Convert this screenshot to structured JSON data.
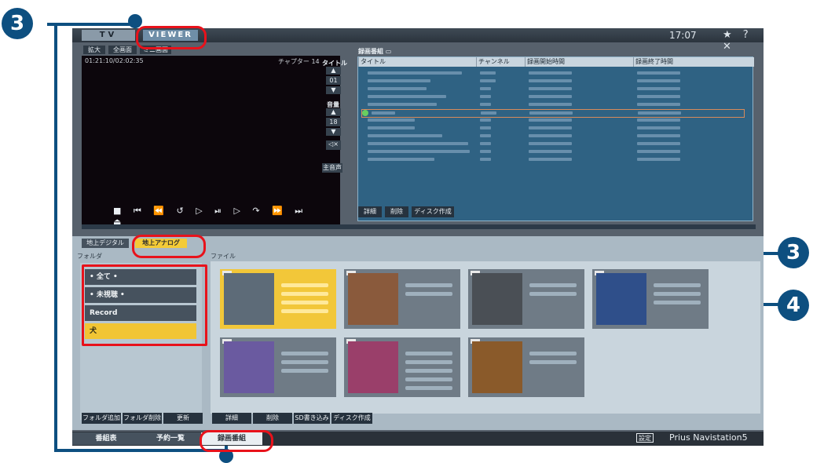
{
  "callouts": {
    "top_left": "3",
    "mid_right": "3",
    "lower_right": "4"
  },
  "top": {
    "tab_tv": "TV",
    "tab_viewer": "VIEWER",
    "clock": "17:07",
    "window_buttons": "★ ? ✕"
  },
  "view_modes": [
    "拡大",
    "全画面",
    "ミニ画面"
  ],
  "player": {
    "time": "01:21:10/02:02:35",
    "chapter": "チャプター 14",
    "transport": "■ ⏮ ⏪ ↺ ▷ ⏯ ▷ ↷ ⏩ ⏭ ⏏"
  },
  "side": {
    "title_label": "タイトル",
    "title_value": "01",
    "volume_label": "音量",
    "volume_value": "18",
    "audio_button": "主音声"
  },
  "recordings": {
    "panel_title": "録画番組",
    "columns": [
      "タイトル",
      "チャンネル",
      "録画開始時間",
      "録画終了時間"
    ],
    "buttons": [
      "詳細",
      "削除",
      "ディスク作成"
    ]
  },
  "lower": {
    "tab_digital": "地上デジタル",
    "tab_analog": "地上アナログ",
    "folder_label": "フォルダ",
    "file_label": "ファイル",
    "folders": [
      "• 全て •",
      "• 未視聴 •",
      "Record",
      "犬"
    ],
    "folder_buttons": [
      "フォルダ追加",
      "フォルダ削除",
      "更新"
    ],
    "file_buttons": [
      "詳細",
      "削除",
      "SD書き込み",
      "ディスク作成"
    ]
  },
  "bottom": {
    "tabs": [
      "番組表",
      "予約一覧",
      "録画番組"
    ],
    "settings": "設定",
    "brand": "Prius Navistation5"
  }
}
